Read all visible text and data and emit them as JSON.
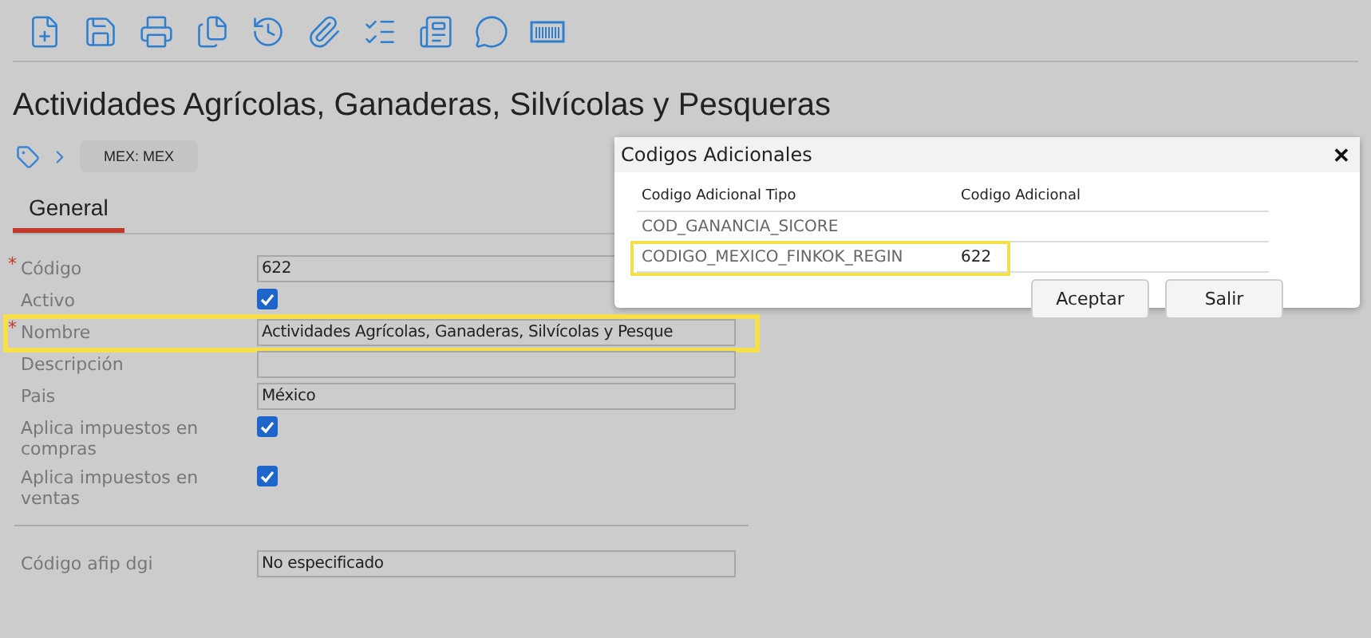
{
  "toolbar": [
    {
      "kind": "new"
    },
    {
      "kind": "save"
    },
    {
      "kind": "print"
    },
    {
      "kind": "copy"
    },
    {
      "kind": "history"
    },
    {
      "kind": "attach"
    },
    {
      "kind": "checklist"
    },
    {
      "kind": "document"
    },
    {
      "kind": "comment"
    },
    {
      "kind": "barcode"
    }
  ],
  "title": "Actividades Agrícolas, Ganaderas, Silvícolas y Pesqueras",
  "breadcrumb": {
    "chip": "MEX: MEX"
  },
  "tabs": [
    {
      "label": "General",
      "selected": true
    }
  ],
  "fields": [
    {
      "kind": "text",
      "label": "Código",
      "required_mark": "*",
      "value": "622",
      "highlighted": false
    },
    {
      "kind": "checkbox",
      "label": "Activo",
      "checked": true,
      "highlighted": false
    },
    {
      "kind": "text",
      "label": "Nombre",
      "required_mark": "*",
      "value": "Actividades Agrícolas, Ganaderas, Silvícolas y Pesque",
      "highlighted": true
    },
    {
      "kind": "text",
      "label": "Descripción",
      "highlighted": false
    },
    {
      "kind": "text",
      "label": "Pais",
      "value": "México",
      "highlighted": false
    },
    {
      "kind": "checkbox",
      "label": "Aplica impuestos en compras",
      "checked": true,
      "highlighted": false
    },
    {
      "kind": "checkbox",
      "label": "Aplica impuestos en ventas",
      "checked": true,
      "highlighted": false
    },
    {
      "kind": "divider"
    },
    {
      "kind": "text",
      "label": "Código afip dgi",
      "value": "No especificado",
      "highlighted": false
    }
  ],
  "dialog": {
    "title": "Codigos Adicionales",
    "close": "✕",
    "columns": [
      "Codigo Adicional Tipo",
      "Codigo Adicional"
    ],
    "rows": [
      {
        "type": "COD_GANANCIA_SICORE",
        "highlighted": false
      },
      {
        "type": "CODIGO_MEXICO_FINKOK_REGIN",
        "code": "622",
        "highlighted": true
      }
    ],
    "buttons": [
      "Aceptar",
      "Salir"
    ]
  }
}
